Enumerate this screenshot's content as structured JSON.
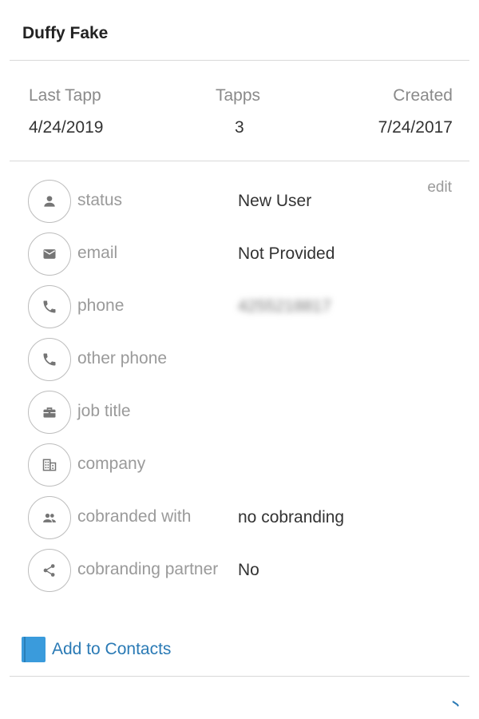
{
  "contact": {
    "name": "Duffy Fake"
  },
  "stats": [
    {
      "label": "Last Tapp",
      "value": "4/24/2019"
    },
    {
      "label": "Tapps",
      "value": "3"
    },
    {
      "label": "Created",
      "value": "7/24/2017"
    }
  ],
  "edit_label": "edit",
  "fields": [
    {
      "label": "status",
      "value": "New User",
      "icon": "person-icon"
    },
    {
      "label": "email",
      "value": "Not Provided",
      "icon": "mail-icon"
    },
    {
      "label": "phone",
      "value": "4255218817",
      "icon": "phone-icon",
      "obscured": true
    },
    {
      "label": "other phone",
      "value": "",
      "icon": "phone-icon"
    },
    {
      "label": "job title",
      "value": "",
      "icon": "briefcase-icon"
    },
    {
      "label": "company",
      "value": "",
      "icon": "building-icon"
    },
    {
      "label": "cobranded with",
      "value": "no cobranding",
      "icon": "group-icon"
    },
    {
      "label": "cobranding partner",
      "value": "No",
      "icon": "share-icon"
    }
  ],
  "actions": {
    "add_to_contacts": "Add to Contacts"
  },
  "colors": {
    "accent": "#2a7ab5",
    "icon_gray": "#757575",
    "book_blue": "#3a9bdc"
  }
}
